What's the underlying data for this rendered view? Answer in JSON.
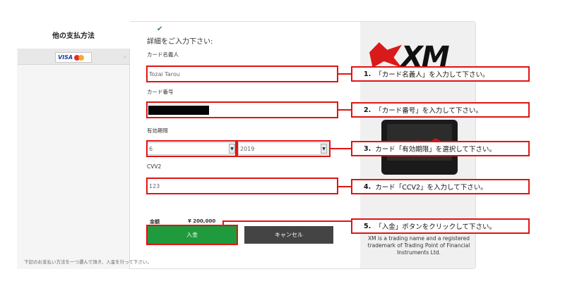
{
  "sidebar": {
    "title": "他の支払方法",
    "method_label": "VISA",
    "footnote": "下記のお支払い方法を一つ選んで頂き、入金を行って下さい。"
  },
  "form": {
    "title": "詳細をご入力下さい:",
    "card_holder_label": "カード名義人",
    "card_holder_value": "Tozai Tarou",
    "card_number_label": "カード番号",
    "expiry_label": "有効期限",
    "expiry_month": "6",
    "expiry_year": "2019",
    "cvv_label": "CVV2",
    "cvv_value": "123",
    "amount_label": "金額",
    "amount_value": "¥ 200,000",
    "pay_button": "入金",
    "cancel_button": "キャンセル"
  },
  "brand": {
    "logo": "XM",
    "text": "XM is a trading name and a registered trademark of Trading Point of Financial Instruments Ltd."
  },
  "annotations": [
    {
      "num": "1.",
      "text": "「カード名義人」を入力して下さい。"
    },
    {
      "num": "2.",
      "text": "「カード番号」を入力して下さい。"
    },
    {
      "num": "3.",
      "text": "カード「有効期限」を選択して下さい。"
    },
    {
      "num": "4.",
      "text": "カード「CCV2」を入力して下さい。"
    },
    {
      "num": "5.",
      "text": "「入金」ボタンをクリックして下さい。"
    }
  ],
  "colors": {
    "annotation_red": "#e11414",
    "pay_green": "#1f9a3c",
    "cancel_dark": "#444444",
    "brand_red": "#d91a1a"
  },
  "icons": {
    "check": "check-icon",
    "visa": "visa-logo-icon",
    "mastercard": "mastercard-logo-icon",
    "select_arrow": "chevron-down-icon"
  }
}
